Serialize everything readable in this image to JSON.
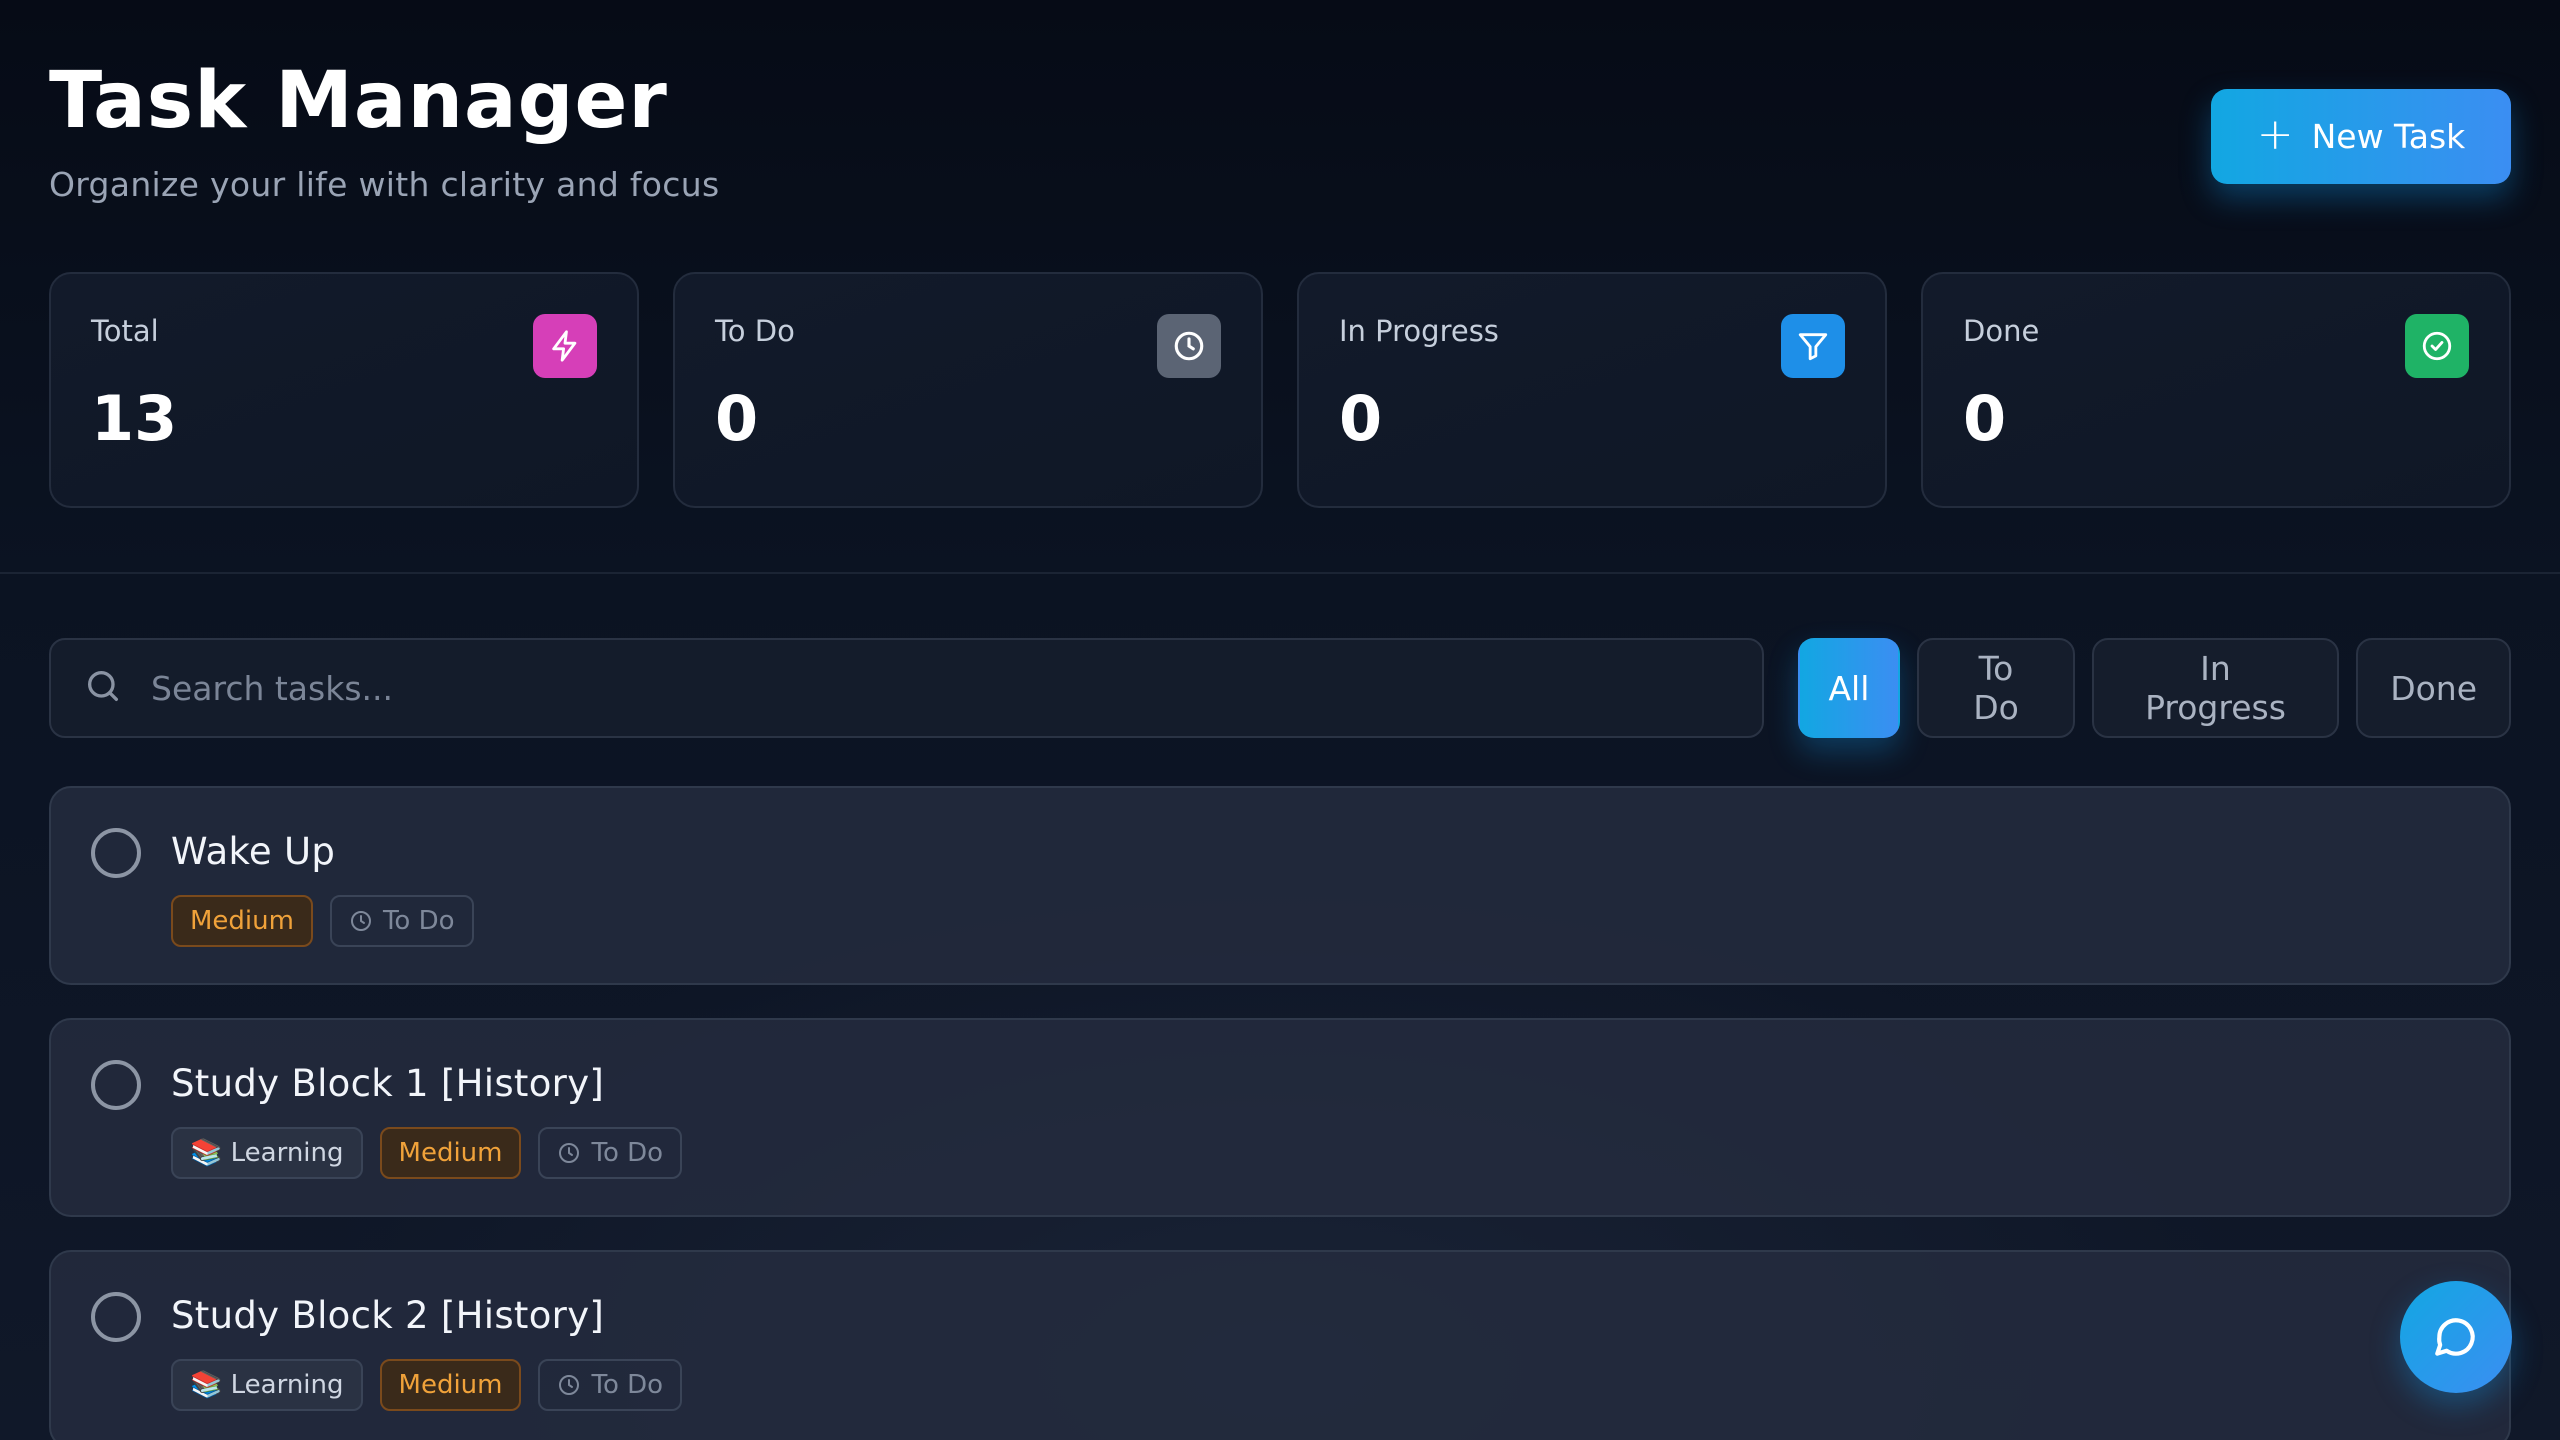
{
  "header": {
    "title": "Task Manager",
    "subtitle": "Organize your life with clarity and focus",
    "new_task_label": "New Task"
  },
  "stats": [
    {
      "label": "Total",
      "value": "13",
      "icon": "bolt-icon",
      "color": "#d63fb8"
    },
    {
      "label": "To Do",
      "value": "0",
      "icon": "clock-icon",
      "color": "#5b6474"
    },
    {
      "label": "In Progress",
      "value": "0",
      "icon": "filter-icon",
      "color": "#1e8fe8"
    },
    {
      "label": "Done",
      "value": "0",
      "icon": "check-circle-icon",
      "color": "#1fb366"
    }
  ],
  "search": {
    "placeholder": "Search tasks...",
    "value": ""
  },
  "filters": [
    {
      "label": "All",
      "active": true
    },
    {
      "label": "To Do",
      "active": false
    },
    {
      "label": "In Progress",
      "active": false
    },
    {
      "label": "Done",
      "active": false
    }
  ],
  "tasks": [
    {
      "title": "Wake Up",
      "category": "",
      "priority": "Medium",
      "status": "To Do"
    },
    {
      "title": "Study Block 1 [History]",
      "category": "📚 Learning",
      "priority": "Medium",
      "status": "To Do"
    },
    {
      "title": "Study Block 2 [History]",
      "category": "📚 Learning",
      "priority": "Medium",
      "status": "To Do"
    }
  ]
}
